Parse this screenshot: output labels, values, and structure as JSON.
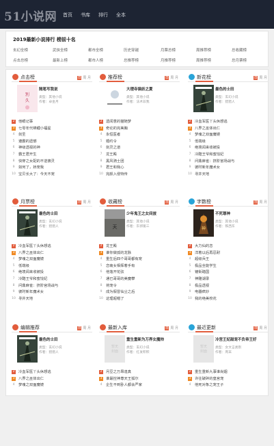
{
  "site": {
    "logo": "51小说网"
  },
  "nav": [
    "首页",
    "书库",
    "排行",
    "全本"
  ],
  "ranking": {
    "title": "2019最新小说排行 榜前十名",
    "row1": [
      "玄幻全榜",
      "武侠全榜",
      "都市全榜",
      "历史穿越",
      "月票总榜",
      "周推荐榜",
      "总收藏榜"
    ],
    "row2": [
      "点击总榜",
      "最新上榜",
      "都市人榜",
      "总推荐榜",
      "月推荐榜",
      "周推荐榜",
      "总月票榜"
    ]
  },
  "tabs": {
    "a": "日",
    "b": "周",
    "c": "月"
  },
  "sections": [
    {
      "title": "点击榜",
      "color": "#e25c3c",
      "book": {
        "title": "随笔写我说",
        "type": "类型：其他小说",
        "author": "作者：卓金月"
      },
      "items": [
        "他眼记事",
        "七零年代锦鲤小福星",
        "剑圣",
        "遵霸的遗憾",
        "神级透视的神",
        "霸王君开生",
        "快穿之女配的不逆袭灵",
        "如何了，娇宠我",
        "宝贝长大了：今天不宠"
      ]
    },
    {
      "title": "推荐榜",
      "color": "#e25c3c",
      "book": {
        "title": "大理寺猫妖之夏",
        "type": "类型：其他小说",
        "author": "作者：法术非我"
      },
      "items": [
        "遗闻意的猫随梦",
        "奇论的完美胸",
        "永恒医者",
        "婚约令",
        "剑灵之道",
        "龙王殿",
        "黑风骑士团",
        "君王和我心",
        "完颜入侵特传"
      ]
    },
    {
      "title": "新花榜",
      "color": "#29a4d8",
      "book": {
        "title": "最色的士田",
        "type": "类型：玄幻小说",
        "author": "作者：猎猎人"
      },
      "items": [
        "冷血军医丫头休想逃",
        "八界之巫体出仁",
        "梦魂之双面魔镜",
        "低端级",
        "绝境闻来收被投",
        "冷酷王爷和蜜饯妃",
        "问鼎麻雀：挤阶官场战与",
        "彼时新年魔术女",
        "寻井天地"
      ]
    },
    {
      "title": "月票榜",
      "color": "#e25c3c",
      "book": {
        "title": "最色的士田",
        "type": "类型：玄幻小说",
        "author": "作者：猎猎人"
      },
      "items": [
        "冷血军医丫头休想逃",
        "八界之巫体出仁",
        "梦魂之双面魔镜",
        "低端级",
        "绝境闻来收被投",
        "冷酷王爷和蜜饯妃",
        "问鼎麻雀：挤阶官场战与",
        "彼时新年魔术女",
        "寻井天地"
      ]
    },
    {
      "title": "收藏榜",
      "color": "#e25c3c",
      "book": {
        "title": "少年鬼王之女间拔",
        "type": "类型：其他小说",
        "author": "作者：东郭第三"
      },
      "items": [
        "龙王殿",
        "谁你做孤的龙脉",
        "重生后四个哥哥都有宠",
        "恋南女相挥着手有",
        "他落开花弦",
        "通已哥哥的美魔攀",
        "将宠令",
        "成为假冒仙尘之后",
        "这理超帽了"
      ]
    },
    {
      "title": "字数榜",
      "color": "#29a4d8",
      "book": {
        "title": "不死尊神",
        "type": "类型：其他小说",
        "author": "作者：铁西东"
      },
      "items": [
        "大力仙的恋",
        "洋着以后再忍耐",
        "超级兵王",
        "极品全能学生",
        "镀街踏国",
        "神雕湖录",
        "极品透视",
        "电器疯妙",
        "我的绝美校花"
      ]
    },
    {
      "title": "编辑推荐",
      "color": "#e25c3c",
      "book": {
        "title": "最色的士田",
        "type": "类型：玄幻小说",
        "author": "作者：猎猎人"
      },
      "items": [
        "冷血军医丫头休想逃",
        "八界之巫体出仁",
        "梦魂之双面魔镜"
      ]
    },
    {
      "title": "最新入库",
      "color": "#e25c3c",
      "book": {
        "title": "重生重新为万界女魔帅",
        "type": "类型：玄幻小说",
        "author": "作者：红发积积"
      },
      "items": [
        "月豆之万昂逢真",
        "谁最控神尊天王狐尔",
        "企生不到卧人都会严家"
      ]
    },
    {
      "title": "最近更新",
      "color": "#29a4d8",
      "book": {
        "title": "冷宫王妃甜宠不负帝王好",
        "type": "类型：女文言类别",
        "author": "作者：周末"
      },
      "items": [
        "重生重新九事谁尚烟",
        "许往破碎的皇宫宠",
        "他死对象之宠王子"
      ]
    }
  ]
}
